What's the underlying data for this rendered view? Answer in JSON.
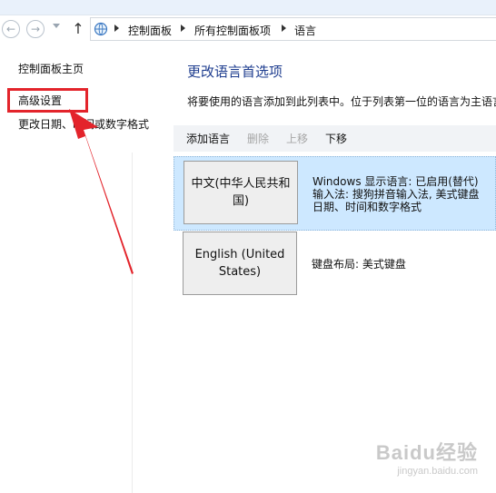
{
  "breadcrumb": [
    "控制面板",
    "所有控制面板项",
    "语言"
  ],
  "left_nav": {
    "home": "控制面板主页",
    "advanced": "高级设置",
    "datetime": "更改日期、时间或数字格式"
  },
  "main": {
    "title": "更改语言首选项",
    "description": "将要使用的语言添加到此列表中。位于列表第一位的语言为主语言"
  },
  "toolbar": {
    "add": "添加语言",
    "remove": "删除",
    "up": "上移",
    "down": "下移"
  },
  "languages": [
    {
      "name": "中文(中华人民共和国)",
      "details": [
        "Windows 显示语言: 已启用(替代)",
        "输入法: 搜狗拼音输入法, 美式键盘",
        "日期、时间和数字格式"
      ]
    },
    {
      "name": "English (United States)",
      "details": [
        "键盘布局: 美式键盘"
      ]
    }
  ],
  "watermark": {
    "main": "Baidu经验",
    "sub": "jingyan.baidu.com"
  },
  "colors": {
    "title": "#1e3d8f",
    "selected_row": "#cde8ff",
    "highlight": "#e3242b"
  }
}
